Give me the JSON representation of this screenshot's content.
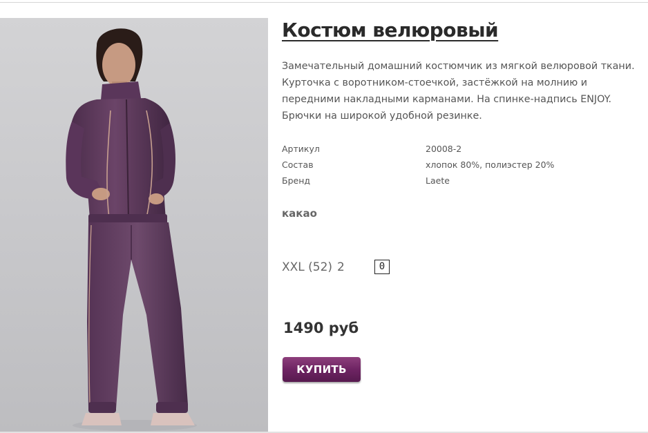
{
  "product": {
    "title": "Костюм велюровый",
    "description": "Замечательный домашний костюмчик из мягкой велюровой ткани. Курточка с воротником-стоечкой, застёжкой на молнию и передними накладными карманами. На спинке-надпись ENJOY. Брючки на широкой удобной резинке.",
    "specs": [
      {
        "label": "Артикул",
        "value": "20008-2"
      },
      {
        "label": "Состав",
        "value": "хлопок 80%, полиэстер 20%"
      },
      {
        "label": "Бренд",
        "value": "Laete"
      }
    ],
    "color": "какао",
    "size": {
      "label": "XXL (52)",
      "stock": "2",
      "quantity": "0"
    },
    "price": "1490 руб",
    "buy_label": "КУПИТЬ"
  },
  "theme": {
    "accent": "#6e2463",
    "suit_color": "#5e3a5e"
  }
}
